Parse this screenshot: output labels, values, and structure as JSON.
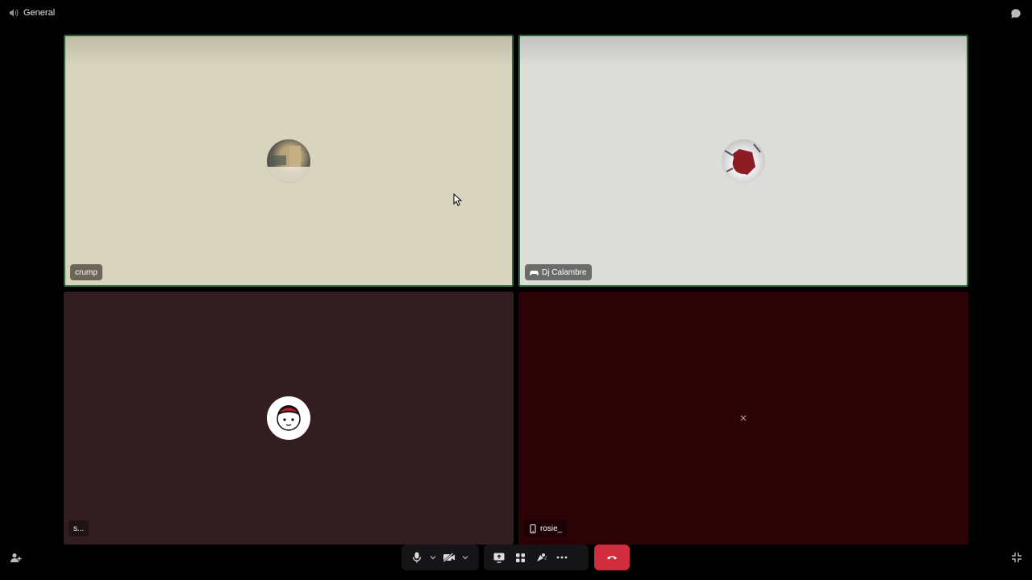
{
  "header": {
    "channel_icon": "speaker-icon",
    "channel_name": "General",
    "chat_icon": "chat-bubble-icon"
  },
  "tiles": [
    {
      "name": "crump",
      "speaking": true,
      "bg": "#d9d4bd"
    },
    {
      "name": "Dj Calambre",
      "speaking": true,
      "bg": "#dcddd8",
      "tag_icon": "game-controller-icon"
    },
    {
      "name": "s...",
      "speaking": false,
      "bg": "#321e21"
    },
    {
      "name": "rosie_",
      "speaking": false,
      "bg": "#2b0307",
      "tag_icon": "phone-icon"
    }
  ],
  "controls": {
    "mic": "microphone-icon",
    "camera": "camera-off-icon",
    "screen_share": "screen-share-icon",
    "activities": "activities-icon",
    "soundboard": "soundboard-icon",
    "more": "more-icon",
    "end_call": "hang-up-icon",
    "invite": "add-user-icon",
    "fullscreen": "exit-fullscreen-icon"
  },
  "colors": {
    "speaking_border": "#2f6b3a",
    "end_call": "#d22d3f",
    "control_bg": "#151517"
  }
}
